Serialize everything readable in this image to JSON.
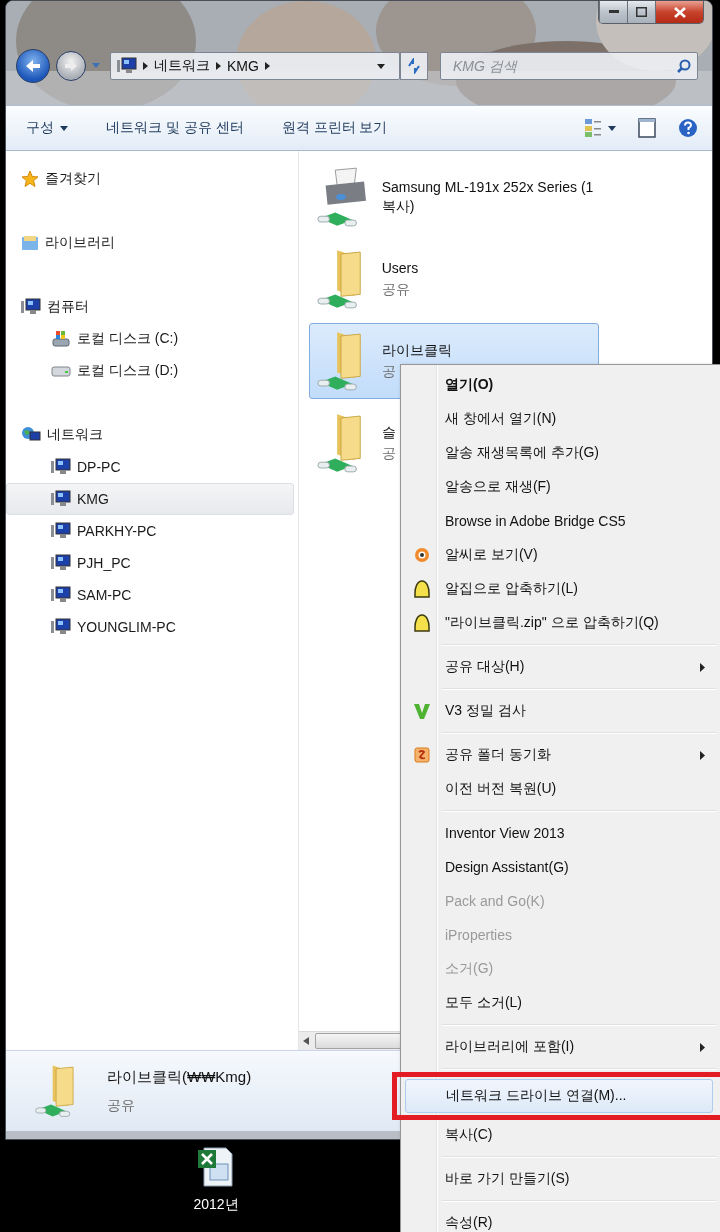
{
  "address": {
    "segments": [
      "네트워크",
      "KMG"
    ]
  },
  "search": {
    "placeholder": "KMG 검색"
  },
  "toolbar": {
    "items": [
      {
        "label": "구성",
        "dropdown": true
      },
      {
        "label": "네트워크 및 공유 센터",
        "dropdown": false
      },
      {
        "label": "원격 프린터 보기",
        "dropdown": false
      }
    ]
  },
  "navigation": [
    {
      "kind": "favorites",
      "label": "즐겨찾기",
      "selected": false
    },
    {
      "kind": "library",
      "label": "라이브러리",
      "selected": false
    },
    {
      "kind": "computer",
      "label": "컴퓨터",
      "selected": false,
      "children": [
        {
          "kind": "system-drive",
          "label": "로컬 디스크 (C:)",
          "selected": false
        },
        {
          "kind": "drive",
          "label": "로컬 디스크 (D:)",
          "selected": false
        }
      ]
    },
    {
      "kind": "network",
      "label": "네트워크",
      "selected": false,
      "children": [
        {
          "kind": "pc",
          "label": "DP-PC",
          "selected": false
        },
        {
          "kind": "pc",
          "label": "KMG",
          "selected": true
        },
        {
          "kind": "pc",
          "label": "PARKHY-PC",
          "selected": false
        },
        {
          "kind": "pc",
          "label": "PJH_PC",
          "selected": false
        },
        {
          "kind": "pc",
          "label": "SAM-PC",
          "selected": false
        },
        {
          "kind": "pc",
          "label": "YOUNGLIM-PC",
          "selected": false
        }
      ]
    }
  ],
  "files": [
    {
      "kind": "printer",
      "name": "Samsung ML-191x 252x Series (1 복사)",
      "selected": false
    },
    {
      "kind": "folder",
      "name": "Users",
      "detail": "공유",
      "selected": false
    },
    {
      "kind": "folder",
      "name": "라이브클릭",
      "detail": "공",
      "selected": true
    },
    {
      "kind": "folder",
      "name": "슬",
      "detail": "공",
      "selected": false
    }
  ],
  "details": {
    "name": "라이브클릭(₩₩Kmg)",
    "detail": "공유"
  },
  "desktop": {
    "icons": [
      {
        "label": "2012년"
      }
    ]
  },
  "context_menu": {
    "items": [
      {
        "kind": "item",
        "label": "열기(O)",
        "default": true,
        "disabled": false,
        "submenu": false,
        "selected": false,
        "annotated": false
      },
      {
        "kind": "item",
        "label": "새 창에서 열기(N)",
        "default": false,
        "disabled": false,
        "submenu": false,
        "selected": false,
        "annotated": false
      },
      {
        "kind": "item",
        "label": "알송 재생목록에 추가(G)",
        "default": false,
        "disabled": false,
        "submenu": false,
        "selected": false,
        "annotated": false
      },
      {
        "kind": "item",
        "label": "알송으로 재생(F)",
        "default": false,
        "disabled": false,
        "submenu": false,
        "selected": false,
        "annotated": false
      },
      {
        "kind": "item",
        "label": "Browse in Adobe Bridge CS5",
        "default": false,
        "disabled": false,
        "submenu": false,
        "selected": false,
        "annotated": false
      },
      {
        "kind": "item",
        "label": "알씨로 보기(V)",
        "default": false,
        "disabled": false,
        "submenu": false,
        "selected": false,
        "annotated": false
      },
      {
        "kind": "item",
        "label": "알집으로 압축하기(L)",
        "default": false,
        "disabled": false,
        "submenu": false,
        "selected": false,
        "annotated": false
      },
      {
        "kind": "item",
        "label": "\"라이브클릭.zip\" 으로 압축하기(Q)",
        "default": false,
        "disabled": false,
        "submenu": false,
        "selected": false,
        "annotated": false
      },
      {
        "kind": "separator"
      },
      {
        "kind": "item",
        "label": "공유 대상(H)",
        "default": false,
        "disabled": false,
        "submenu": true,
        "selected": false,
        "annotated": false
      },
      {
        "kind": "separator"
      },
      {
        "kind": "item",
        "label": "V3 정밀 검사",
        "default": false,
        "disabled": false,
        "submenu": false,
        "selected": false,
        "annotated": false
      },
      {
        "kind": "separator"
      },
      {
        "kind": "item",
        "label": "공유 폴더 동기화",
        "default": false,
        "disabled": false,
        "submenu": true,
        "selected": false,
        "annotated": false
      },
      {
        "kind": "item",
        "label": "이전 버전 복원(U)",
        "default": false,
        "disabled": false,
        "submenu": false,
        "selected": false,
        "annotated": false
      },
      {
        "kind": "separator"
      },
      {
        "kind": "item",
        "label": "Inventor View 2013",
        "default": false,
        "disabled": false,
        "submenu": false,
        "selected": false,
        "annotated": false
      },
      {
        "kind": "item",
        "label": "Design Assistant(G)",
        "default": false,
        "disabled": false,
        "submenu": false,
        "selected": false,
        "annotated": false
      },
      {
        "kind": "item",
        "label": "Pack and Go(K)",
        "default": false,
        "disabled": true,
        "submenu": false,
        "selected": false,
        "annotated": false
      },
      {
        "kind": "item",
        "label": "iProperties",
        "default": false,
        "disabled": true,
        "submenu": false,
        "selected": false,
        "annotated": false
      },
      {
        "kind": "item",
        "label": "소거(G)",
        "default": false,
        "disabled": true,
        "submenu": false,
        "selected": false,
        "annotated": false
      },
      {
        "kind": "item",
        "label": "모두 소거(L)",
        "default": false,
        "disabled": false,
        "submenu": false,
        "selected": false,
        "annotated": false
      },
      {
        "kind": "separator"
      },
      {
        "kind": "item",
        "label": "라이브러리에 포함(I)",
        "default": false,
        "disabled": false,
        "submenu": true,
        "selected": false,
        "annotated": false
      },
      {
        "kind": "separator"
      },
      {
        "kind": "item",
        "label": "네트워크 드라이브 연결(M)...",
        "default": false,
        "disabled": false,
        "submenu": false,
        "selected": true,
        "annotated": true
      },
      {
        "kind": "item",
        "label": "복사(C)",
        "default": false,
        "disabled": false,
        "submenu": false,
        "selected": false,
        "annotated": false
      },
      {
        "kind": "separator"
      },
      {
        "kind": "item",
        "label": "바로 가기 만들기(S)",
        "default": false,
        "disabled": false,
        "submenu": false,
        "selected": false,
        "annotated": false
      },
      {
        "kind": "separator"
      },
      {
        "kind": "item",
        "label": "속성(R)",
        "default": false,
        "disabled": false,
        "submenu": false,
        "selected": false,
        "annotated": false
      }
    ]
  }
}
